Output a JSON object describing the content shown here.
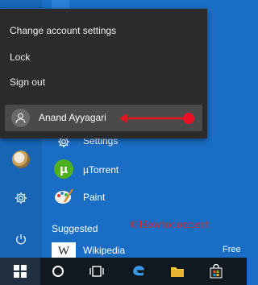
{
  "account_menu": {
    "items": [
      "Change account settings",
      "Lock",
      "Sign out"
    ],
    "current_user": "Anand Ayyagari"
  },
  "apps": [
    {
      "label": "Settings",
      "icon": "gear-icon"
    },
    {
      "label": "µTorrent",
      "icon": "utorrent-icon"
    },
    {
      "label": "Paint",
      "icon": "paint-icon"
    }
  ],
  "suggested": {
    "title": "Suggested",
    "app": "Wikipedia",
    "price": "Free",
    "tile_letter": "W"
  },
  "watermark": "©Howtoconnect",
  "colors": {
    "start_bg": "#1a6dc4",
    "menu_bg": "#2b2b2b",
    "highlight": "#4a4a4a",
    "arrow": "#e81123",
    "taskbar": "#101820"
  }
}
